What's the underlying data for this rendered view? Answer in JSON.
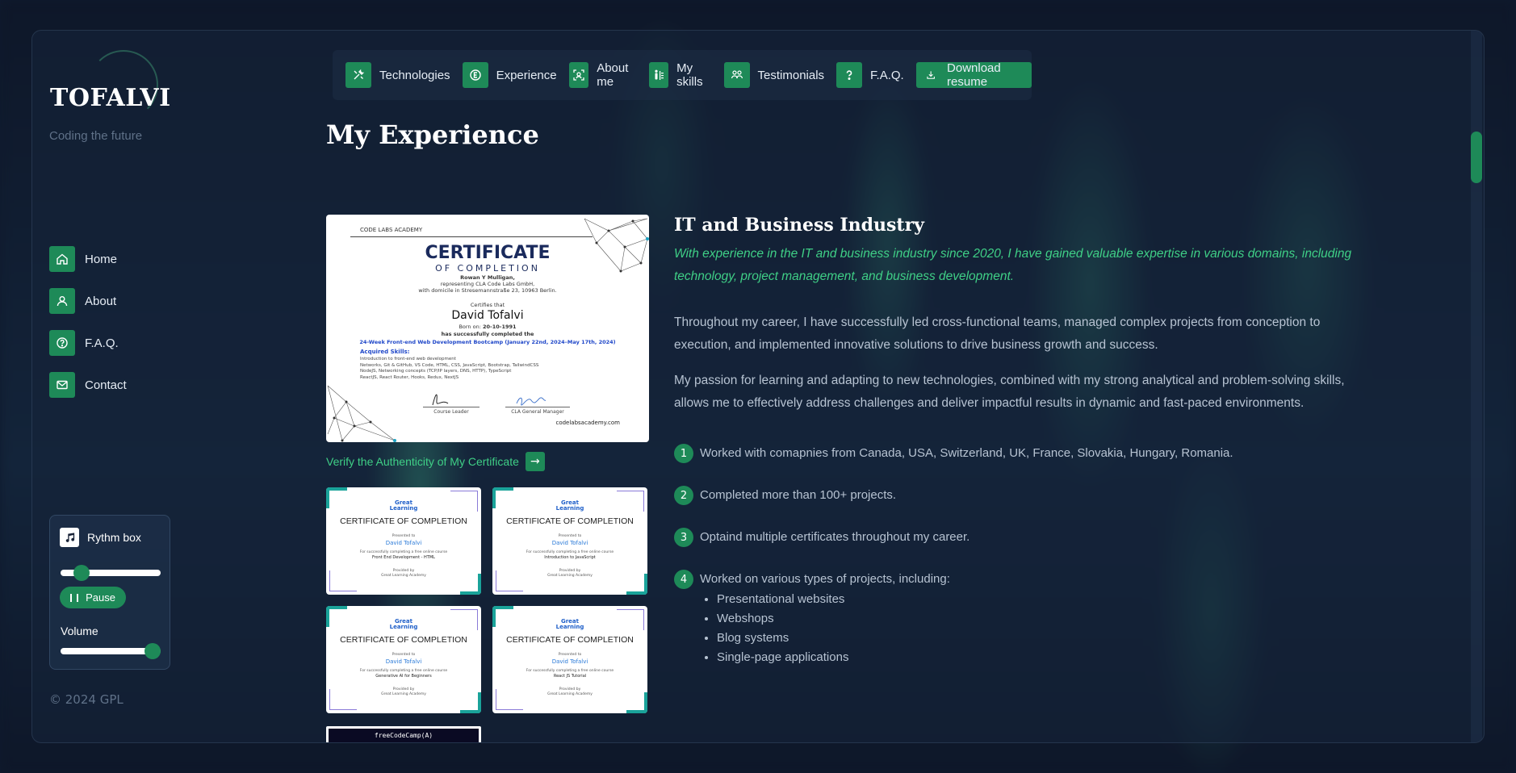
{
  "brand": {
    "logo": "TOFALVI",
    "tagline": "Coding the future"
  },
  "side_nav": [
    {
      "label": "Home",
      "icon": "home-icon"
    },
    {
      "label": "About",
      "icon": "user-icon"
    },
    {
      "label": "F.A.Q.",
      "icon": "question-circle-icon"
    },
    {
      "label": "Contact",
      "icon": "mail-icon"
    }
  ],
  "rythm_box": {
    "title": "Rythm box",
    "pause_label": "Pause",
    "volume_label": "Volume",
    "progress": 0.15,
    "volume": 1.0
  },
  "copyright": "© 2024 GPL",
  "top_nav": [
    {
      "label": "Technologies",
      "icon": "tools-icon"
    },
    {
      "label": "Experience",
      "icon": "experience-icon"
    },
    {
      "label": "About me",
      "icon": "face-scan-icon"
    },
    {
      "label": "My skills",
      "icon": "skills-icon"
    },
    {
      "label": "Testimonials",
      "icon": "people-icon"
    },
    {
      "label": "F.A.Q.",
      "icon": "question-icon"
    }
  ],
  "download_label": "Download resume",
  "page_title": "My Experience",
  "main_cert": {
    "academy": "CODE LABS ACADEMY",
    "title": "CERTIFICATE",
    "subtitle": "OF COMPLETION",
    "issuer": "Rowan Y Mulligan,",
    "representing": "representing CLA Code Labs GmbH,",
    "domicile": "with domicile in Stresemannstraße 23, 10963 Berlin.",
    "certifies": "Certifies that",
    "name": "David Tofalvi",
    "born": "Born on:",
    "born_date": "20-10-1991",
    "completed": "has successfully completed the",
    "course": "24-Week Front-end Web Development Bootcamp (January 22nd, 2024–May 17th, 2024)",
    "skills_heading": "Acquired Skills:",
    "skills": [
      "Introduction to front-end web development",
      "Networks, Git & GitHub, VS Code, HTML, CSS, JavaScript, Bootstrap, TailwindCSS",
      "NodeJS, Networking concepts (TCP/IP layers, DNS, HTTP), TypeScript",
      "ReactJS, React Router, Hooks, Redux, NextJS"
    ],
    "sig_left": "Course Leader",
    "sig_right": "CLA General Manager",
    "url": "codelabsacademy.com"
  },
  "verify_label": "Verify the Authenticity of My Certificate",
  "small_certs": [
    {
      "logo1": "Great",
      "logo2": "Learning",
      "title": "CERTIFICATE OF COMPLETION",
      "presented": "Presented to",
      "name": "David Tofalvi",
      "for": "For successfully completing a free online course",
      "course": "Front End Development - HTML",
      "provided": "Provided by",
      "provider": "Great Learning Academy"
    },
    {
      "logo1": "Great",
      "logo2": "Learning",
      "title": "CERTIFICATE OF COMPLETION",
      "presented": "Presented to",
      "name": "David Tofalvi",
      "for": "For successfully completing a free online course",
      "course": "Introduction to JavaScript",
      "provided": "Provided by",
      "provider": "Great Learning Academy"
    },
    {
      "logo1": "Great",
      "logo2": "Learning",
      "title": "CERTIFICATE OF COMPLETION",
      "presented": "Presented to",
      "name": "David Tofalvi",
      "for": "For successfully completing a free online course",
      "course": "Generative AI for Beginners",
      "provided": "Provided by",
      "provider": "Great Learning Academy"
    },
    {
      "logo1": "Great",
      "logo2": "Learning",
      "title": "CERTIFICATE OF COMPLETION",
      "presented": "Presented to",
      "name": "David Tofalvi",
      "for": "For successfully completing a free online course",
      "course": "React JS Tutorial",
      "provided": "Provided by",
      "provider": "Great Learning Academy"
    }
  ],
  "fcc_label": "freeCodeCamp(A)",
  "industry": {
    "title": "IT and Business Industry",
    "lead": "With experience in the IT and business industry since 2020, I have gained valuable expertise in various domains, including technology, project management, and business development.",
    "para1": "Throughout my career, I have successfully led cross-functional teams, managed complex projects from conception to execution, and implemented innovative solutions to drive business growth and success.",
    "para2": "My passion for learning and adapting to new technologies, combined with my strong analytical and problem-solving skills, allows me to effectively address challenges and deliver impactful results in dynamic and fast-paced environments.",
    "points": [
      {
        "num": "1",
        "text": "Worked with comapnies from Canada, USA, Switzerland, UK, France, Slovakia, Hungary, Romania."
      },
      {
        "num": "2",
        "text": "Completed more than 100+ projects."
      },
      {
        "num": "3",
        "text": "Optaind multiple certificates throughout my career."
      },
      {
        "num": "4",
        "text": "Worked on various types of projects, including:"
      }
    ],
    "project_types": [
      "Presentational websites",
      "Webshops",
      "Blog systems",
      "Single-page applications"
    ]
  },
  "colors": {
    "accent": "#1e8a58",
    "accent_text": "#3fcf86",
    "background": "#0f1a2e"
  }
}
